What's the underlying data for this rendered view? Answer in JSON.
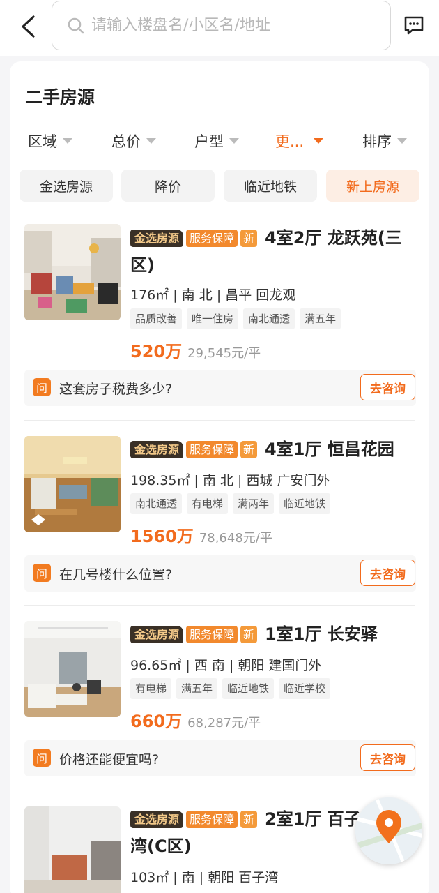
{
  "search": {
    "placeholder": "请输入楼盘名/小区名/地址"
  },
  "icons": {
    "back": "back-arrow-icon",
    "search": "search-icon",
    "message": "message-icon",
    "map": "map-pin-icon"
  },
  "section_title": "二手房源",
  "filters": [
    {
      "label": "区域",
      "active": false
    },
    {
      "label": "总价",
      "active": false
    },
    {
      "label": "户型",
      "active": false
    },
    {
      "label": "更...",
      "active": true
    },
    {
      "label": "排序",
      "active": false
    }
  ],
  "chips": [
    {
      "label": "金选房源",
      "active": false
    },
    {
      "label": "降价",
      "active": false
    },
    {
      "label": "临近地铁",
      "active": false
    },
    {
      "label": "新上房源",
      "active": true
    }
  ],
  "badge_labels": {
    "gold": "金选房源",
    "service": "服务保障",
    "new": "新"
  },
  "consult_label": "去咨询",
  "question_icon": "问",
  "listings": [
    {
      "title": "4室2厅 龙跃苑(三区)",
      "info": "176㎡ | 南 北 | 昌平 回龙观",
      "tags": [
        "品质改善",
        "唯一住房",
        "南北通透",
        "满五年"
      ],
      "price": "520万",
      "unit_price": "29,545元/平",
      "question": "这套房子税费多少?"
    },
    {
      "title": "4室1厅 恒昌花园",
      "info": "198.35㎡ | 南 北 | 西城 广安门外",
      "tags": [
        "南北通透",
        "有电梯",
        "满两年",
        "临近地铁"
      ],
      "price": "1560万",
      "unit_price": "78,648元/平",
      "question": "在几号楼什么位置?"
    },
    {
      "title": "1室1厅 长安驿",
      "info": "96.65㎡ | 西 南 | 朝阳 建国门外",
      "tags": [
        "有电梯",
        "满五年",
        "临近地铁",
        "临近学校"
      ],
      "price": "660万",
      "unit_price": "68,287元/平",
      "question": "价格还能便宜吗?"
    },
    {
      "title": "2室1厅 百子湾(C区)",
      "info": "103㎡ | 南 | 朝阳 百子湾"
    }
  ],
  "colors": {
    "accent": "#f26b1d",
    "gold_badge_bg": "#3a3026",
    "gold_badge_text": "#f3c989",
    "service_badge": "#f2892d"
  }
}
